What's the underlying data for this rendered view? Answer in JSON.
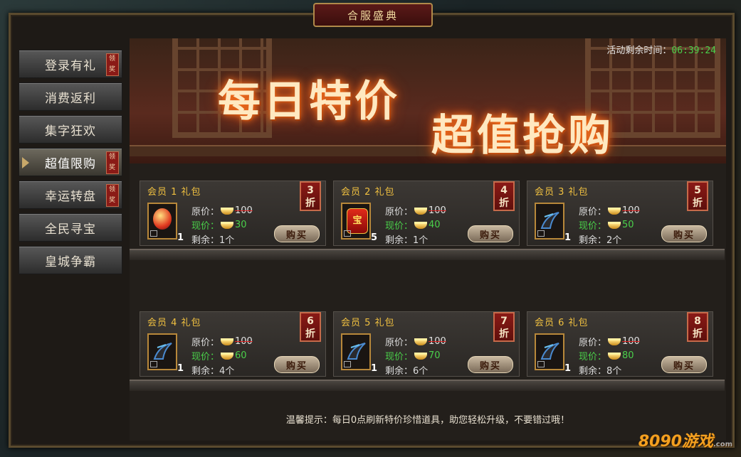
{
  "window": {
    "title": "合服盛典"
  },
  "sidebar": {
    "items": [
      {
        "label": "登录有礼",
        "badge": "领奖"
      },
      {
        "label": "消费返利",
        "badge": ""
      },
      {
        "label": "集字狂欢",
        "badge": ""
      },
      {
        "label": "超值限购",
        "badge": "领奖",
        "active": true
      },
      {
        "label": "幸运转盘",
        "badge": "领奖"
      },
      {
        "label": "全民寻宝",
        "badge": ""
      },
      {
        "label": "皇城争霸",
        "badge": ""
      }
    ]
  },
  "banner": {
    "slogan_1": "每日特价",
    "slogan_2": "超值抢购",
    "timer_label": "活动剩余时间：",
    "timer_value": "06:39:24"
  },
  "labels": {
    "original": "原价：",
    "current": "现价：",
    "remain_prefix": "剩余："
  },
  "packages": [
    {
      "title": "会员 1 礼包",
      "discount": "3",
      "discount_unit": "折",
      "original": "100",
      "current": "30",
      "remain": "1个",
      "qty": "1",
      "buy": "购买",
      "icon": "gem-orb-icon"
    },
    {
      "title": "会员 2 礼包",
      "discount": "4",
      "discount_unit": "折",
      "original": "100",
      "current": "40",
      "remain": "1个",
      "qty": "5",
      "buy": "购买",
      "icon": "red-pouch-icon"
    },
    {
      "title": "会员 3 礼包",
      "discount": "5",
      "discount_unit": "折",
      "original": "100",
      "current": "50",
      "remain": "2个",
      "qty": "1",
      "buy": "购买",
      "icon": "claw-weapon-icon"
    },
    {
      "title": "会员 4 礼包",
      "discount": "6",
      "discount_unit": "折",
      "original": "100",
      "current": "60",
      "remain": "4个",
      "qty": "1",
      "buy": "购买",
      "icon": "claw-weapon-icon"
    },
    {
      "title": "会员 5 礼包",
      "discount": "7",
      "discount_unit": "折",
      "original": "100",
      "current": "70",
      "remain": "6个",
      "qty": "1",
      "buy": "购买",
      "icon": "claw-weapon-icon"
    },
    {
      "title": "会员 6 礼包",
      "discount": "8",
      "discount_unit": "折",
      "original": "100",
      "current": "80",
      "remain": "8个",
      "qty": "1",
      "buy": "购买",
      "icon": "claw-weapon-icon"
    }
  ],
  "tip": "温馨提示：每日0点刷新特价珍惜道具，助您轻松升级，不要错过哦！",
  "watermark": {
    "brand": "8090游戏",
    "domain": ".com"
  }
}
